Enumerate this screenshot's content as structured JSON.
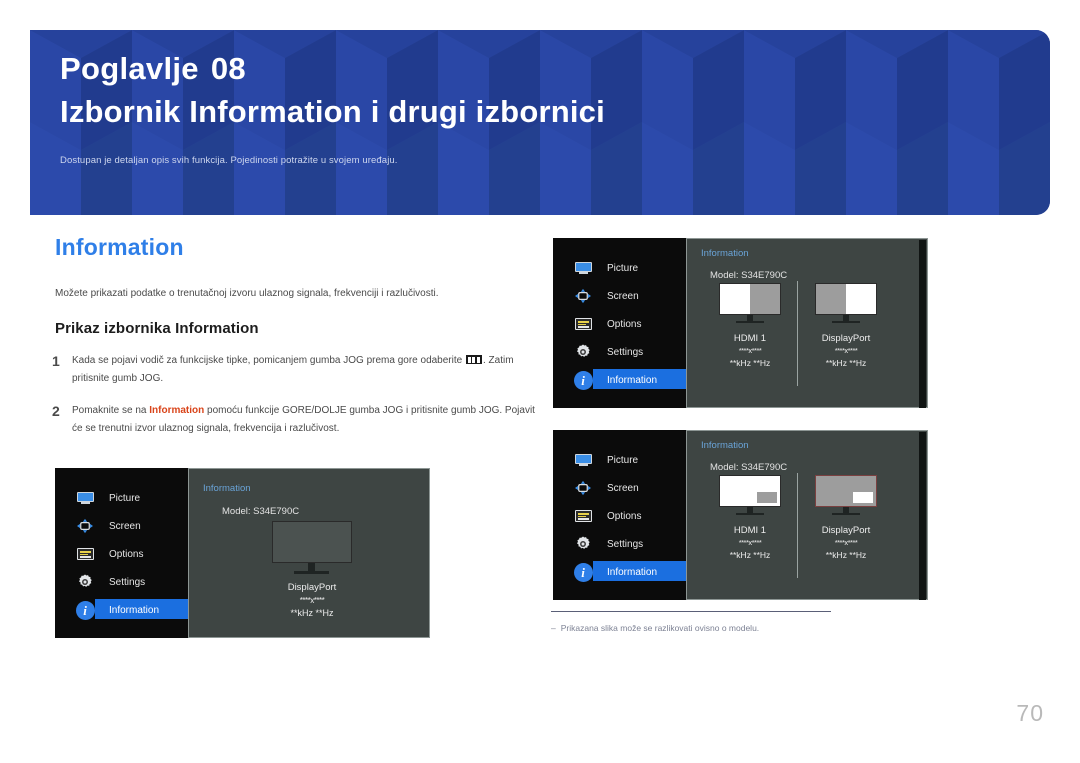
{
  "header": {
    "chapter_label": "Poglavlje",
    "chapter_number": "08",
    "title": "Izbornik Information i drugi izbornici",
    "subtitle": "Dostupan je detaljan opis svih funkcija. Pojedinosti potražite u svojem uređaju.",
    "bg_color": "#25419a"
  },
  "section": {
    "title": "Information",
    "title_color": "#2f7fe8",
    "description": "Možete prikazati podatke o trenutačnoj izvoru ulaznog signala, frekvenciji i razlučivosti.",
    "sub_heading": "Prikaz izbornika Information"
  },
  "steps": [
    {
      "num": "1",
      "text_before": "Kada se pojavi vodič za funkcijske tipke, pomicanjem gumba JOG prema gore odaberite ",
      "icon": "jog-menu-icon",
      "text_after": ". Zatim pritisnite gumb JOG."
    },
    {
      "num": "2",
      "text_before": "Pomaknite se na ",
      "keyword": "Information",
      "text_after": " pomoću funkcije GORE/DOLJE gumba JOG i pritisnite gumb JOG. Pojavit će se trenutni izvor ulaznog signala, frekvencija i razlučivost.",
      "keyword_color": "#d9441a"
    }
  ],
  "osd_menu_items": [
    {
      "label": "Picture",
      "icon": "monitor-icon",
      "active": false
    },
    {
      "label": "Screen",
      "icon": "arrows-cross-icon",
      "active": false
    },
    {
      "label": "Options",
      "icon": "list-lines-icon",
      "active": false
    },
    {
      "label": "Settings",
      "icon": "gear-icon",
      "active": false
    },
    {
      "label": "Information",
      "icon": "info-circle-icon",
      "active": true
    }
  ],
  "osd_panel": {
    "title": "Information",
    "model_label": "Model: S34E790C",
    "highlight_color": "#1b6fe0",
    "title_color": "#6aa4d8",
    "panel_bg": "#3e4543",
    "sidebar_bg": "#0b0b0b"
  },
  "osd_single": {
    "source": "DisplayPort",
    "resolution": "****x****",
    "frequency": "**kHz **Hz"
  },
  "osd_dual_split": {
    "left": {
      "source": "HDMI 1",
      "resolution": "****x****",
      "frequency": "**kHz **Hz",
      "mode": "split-left-white"
    },
    "right": {
      "source": "DisplayPort",
      "resolution": "****x****",
      "frequency": "**kHz **Hz",
      "mode": "split-right-white"
    }
  },
  "osd_dual_pip": {
    "left": {
      "source": "HDMI 1",
      "resolution": "****x****",
      "frequency": "**kHz **Hz",
      "mode": "pip-white-main"
    },
    "right": {
      "source": "DisplayPort",
      "resolution": "****x****",
      "frequency": "**kHz **Hz",
      "mode": "pip-gray-main"
    }
  },
  "footnote": {
    "dash": "‒",
    "text": "Prikazana slika može se razlikovati ovisno o modelu."
  },
  "page_number": "70"
}
